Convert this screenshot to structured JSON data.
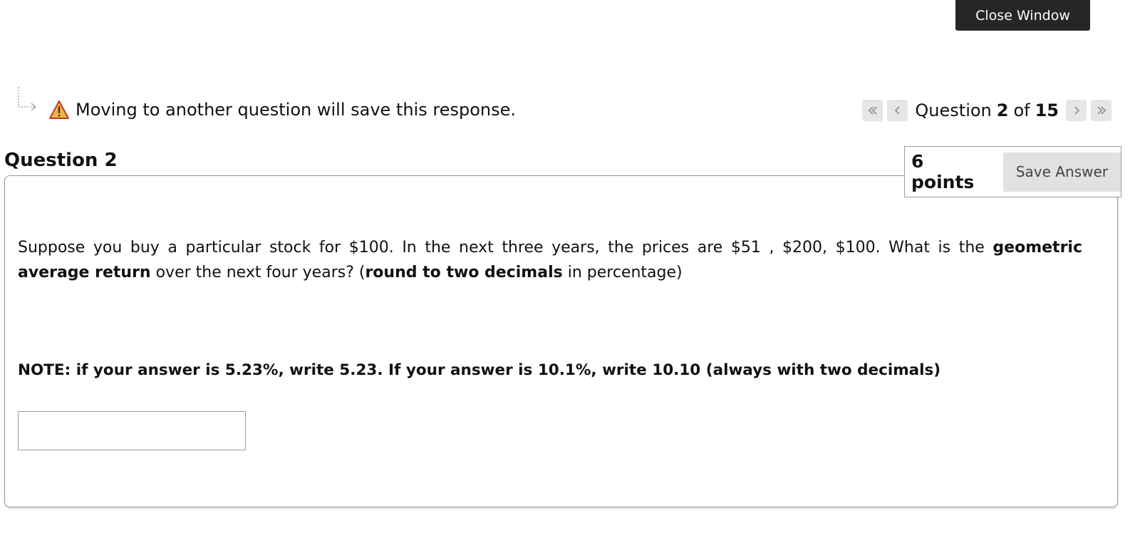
{
  "header": {
    "close_label": "Close Window"
  },
  "notice": {
    "text": "Moving to another question will save this response."
  },
  "navigation": {
    "prefix": "Question",
    "current": "2",
    "of": "of",
    "total": "15"
  },
  "question": {
    "title": "Question 2",
    "points": "6 points",
    "save_label": "Save Answer",
    "text_1": "Suppose you buy a particular stock for $100. In the next three years, the prices are $51 , $200, $100.  What is the ",
    "text_bold_1": "geometric average return",
    "text_2": " over the next four years? (",
    "text_bold_2": "round to two decimals",
    "text_3": " in percentage)",
    "note": "NOTE: if your answer is 5.23%, write 5.23. If your answer is 10.1%, write 10.10 (always with two decimals)",
    "answer_value": ""
  },
  "colors": {
    "close_bg": "#262626",
    "warn": "#f0a030",
    "save_bg": "#e1e1e1"
  }
}
